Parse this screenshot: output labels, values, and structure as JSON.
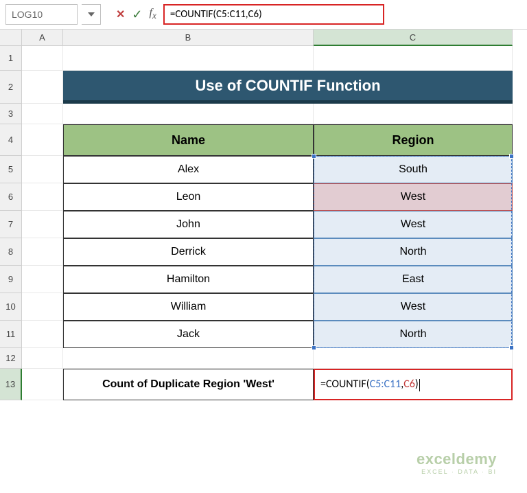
{
  "namebox": "LOG10",
  "formula_bar": "=COUNTIF(C5:C11,C6)",
  "columns": [
    "A",
    "B",
    "C"
  ],
  "rows": [
    "1",
    "2",
    "3",
    "4",
    "5",
    "6",
    "7",
    "8",
    "9",
    "10",
    "11",
    "12",
    "13"
  ],
  "title": "Use of COUNTIF Function",
  "headers": {
    "name": "Name",
    "region": "Region"
  },
  "data": [
    {
      "name": "Alex",
      "region": "South"
    },
    {
      "name": "Leon",
      "region": "West"
    },
    {
      "name": "John",
      "region": "West"
    },
    {
      "name": "Derrick",
      "region": "North"
    },
    {
      "name": "Hamilton",
      "region": "East"
    },
    {
      "name": "William",
      "region": "West"
    },
    {
      "name": "Jack",
      "region": "North"
    }
  ],
  "count_label": "Count of Duplicate Region 'West'",
  "formula_display": {
    "prefix": "=COUNTIF(",
    "range": "C5:C11",
    "sep": ",",
    "criteria": "C6",
    "suffix": ")"
  },
  "watermark": {
    "line1": "exceldemy",
    "line2": "EXCEL · DATA · BI"
  }
}
